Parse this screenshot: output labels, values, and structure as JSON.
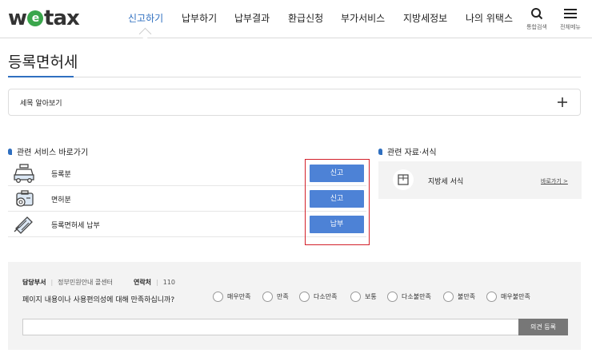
{
  "header": {
    "logo_pre": "w",
    "logo_mid": "e",
    "logo_post": "tax",
    "nav": [
      "신고하기",
      "납부하기",
      "납부결과",
      "환급신청",
      "부가서비스",
      "지방세정보",
      "나의 위택스"
    ],
    "active_nav_index": 0,
    "search_label": "통합검색",
    "menu_label": "전체메뉴"
  },
  "page": {
    "title": "등록면허세",
    "accordion_label": "세목 알아보기"
  },
  "related_services": {
    "heading": "관련 서비스 바로가기",
    "items": [
      {
        "label": "등록분",
        "button": "신고",
        "icon": "car-icon"
      },
      {
        "label": "면허분",
        "button": "신고",
        "icon": "license-icon"
      },
      {
        "label": "등록면허세 납부",
        "button": "납부",
        "icon": "pay-icon"
      }
    ]
  },
  "related_docs": {
    "heading": "관련 자료·서식",
    "item_label": "지방세 서식",
    "link_label": "바로가기 >"
  },
  "survey": {
    "dept_label": "담당부서",
    "dept_value": "정부민원안내 콜센터",
    "contact_label": "연락처",
    "contact_value": "110",
    "question": "페이지 내용이나 사용편의성에 대해 만족하십니까?",
    "options": [
      "매우만족",
      "만족",
      "다소만족",
      "보통",
      "다소불만족",
      "불만족",
      "매우불만족"
    ],
    "input_placeholder": "",
    "submit_label": "의견 등록"
  },
  "colors": {
    "accent": "#2f6fc0",
    "button": "#4d82d6",
    "highlight_box": "#d3202a",
    "logo_green": "#3aa64c"
  }
}
